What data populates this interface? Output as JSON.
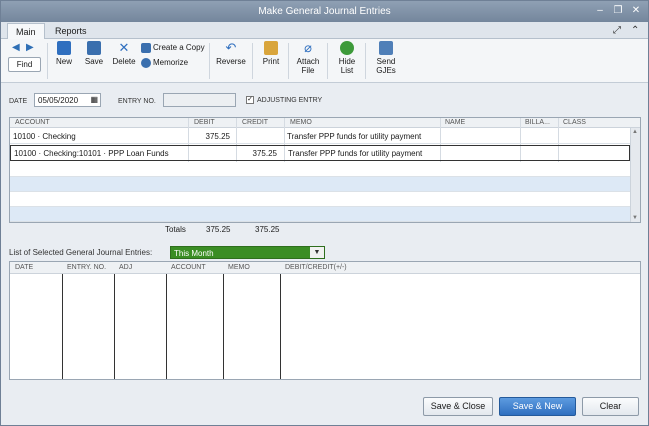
{
  "window": {
    "title": "Make General Journal Entries"
  },
  "tabs": [
    {
      "label": "Main"
    },
    {
      "label": "Reports"
    }
  ],
  "toolbar": {
    "find": "Find",
    "new": "New",
    "save": "Save",
    "delete": "Delete",
    "create_copy": "Create a Copy",
    "memorize": "Memorize",
    "reverse": "Reverse",
    "print": "Print",
    "attach_file_1": "Attach",
    "attach_file_2": "File",
    "hide_list_1": "Hide",
    "hide_list_2": "List",
    "send_gjes_1": "Send",
    "send_gjes_2": "GJEs"
  },
  "form": {
    "date_label": "DATE",
    "date_value": "05/05/2020",
    "entry_no_label": "ENTRY NO.",
    "entry_no_value": "",
    "adjusting_label": "ADJUSTING ENTRY"
  },
  "grid": {
    "headers": [
      "ACCOUNT",
      "DEBIT",
      "CREDIT",
      "MEMO",
      "NAME",
      "BILLA...",
      "CLASS"
    ],
    "rows": [
      {
        "account": "10100 · Checking",
        "debit": "375.25",
        "credit": "",
        "memo": "Transfer PPP funds for utility payment"
      },
      {
        "account": "10100 · Checking:10101 · PPP Loan Funds",
        "debit": "",
        "credit": "375.25",
        "memo": "Transfer PPP funds for utility payment"
      }
    ],
    "totals_label": "Totals",
    "totals_debit": "375.25",
    "totals_credit": "375.25"
  },
  "list": {
    "label": "List of Selected General Journal Entries:",
    "filter": "This Month",
    "headers": [
      "DATE",
      "ENTRY. NO.",
      "ADJ",
      "ACCOUNT",
      "MEMO",
      "DEBIT/CREDIT(+/-)"
    ]
  },
  "buttons": {
    "save_close": "Save & Close",
    "save_new": "Save & New",
    "clear": "Clear"
  },
  "colors": {
    "accent": "#2f6fbf",
    "filter_bg": "#3a8d24"
  }
}
